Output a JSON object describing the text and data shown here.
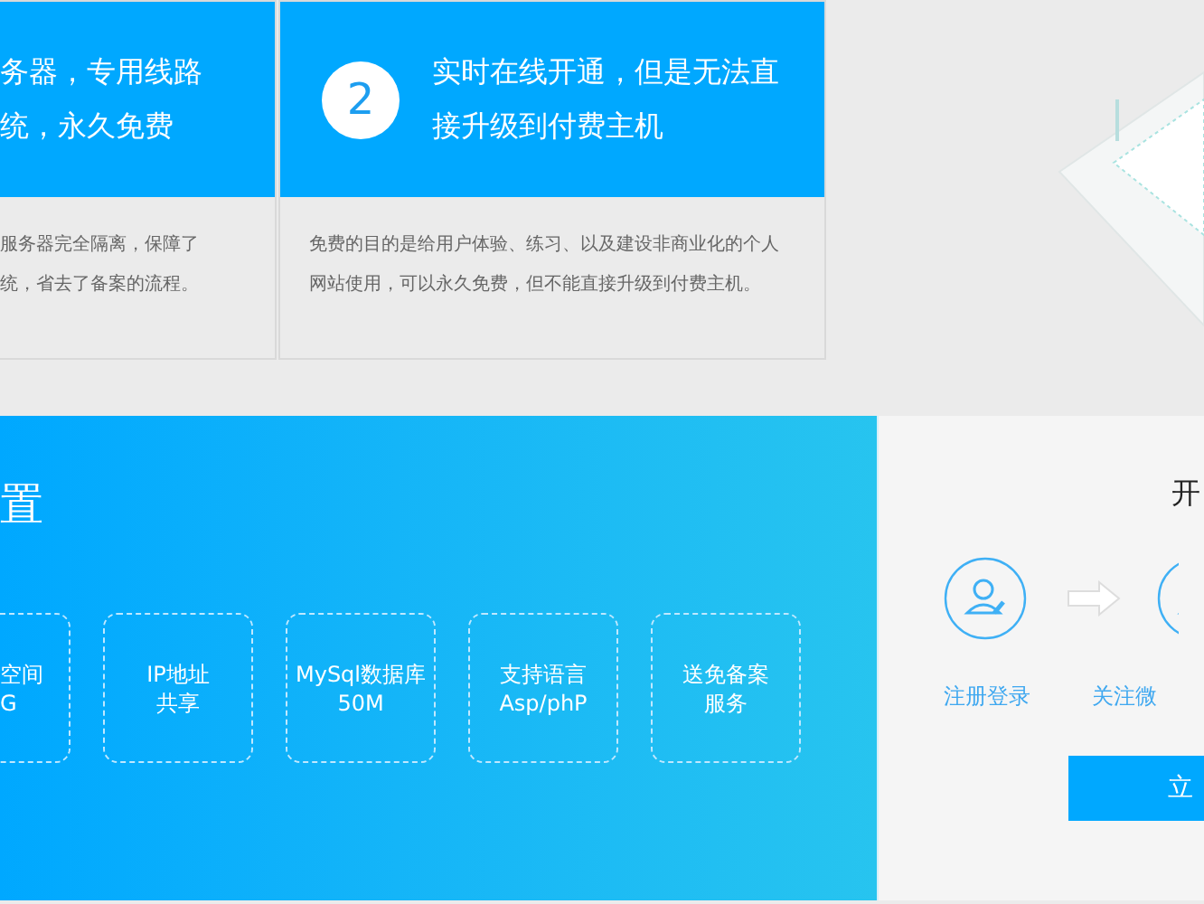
{
  "features": [
    {
      "title_lines": [
        "务器，专用线路",
        "统，永久免费"
      ],
      "body_lines": [
        "服务器完全隔离，保障了",
        "统，省去了备案的流程。"
      ]
    },
    {
      "number": "2",
      "title_lines": [
        "实时在线开通，但是无法直",
        "接升级到付费主机"
      ],
      "body_lines": [
        "免费的目的是给用户体验、练习、以及建设非商业化的个人",
        "网站使用，可以永久免费，但不能直接升级到付费主机。"
      ]
    }
  ],
  "config": {
    "title": "置",
    "items": [
      {
        "lines": [
          "空间",
          "G"
        ]
      },
      {
        "lines": [
          "IP地址",
          "共享"
        ]
      },
      {
        "lines": [
          "MySql数据库",
          "50M"
        ]
      },
      {
        "lines": [
          "支持语言",
          "Asp/phP"
        ]
      },
      {
        "lines": [
          "送免备案",
          "服务"
        ]
      }
    ]
  },
  "signup": {
    "title": "开",
    "steps": [
      {
        "label": "注册登录"
      },
      {
        "label": "关注微"
      }
    ],
    "button": "立"
  }
}
